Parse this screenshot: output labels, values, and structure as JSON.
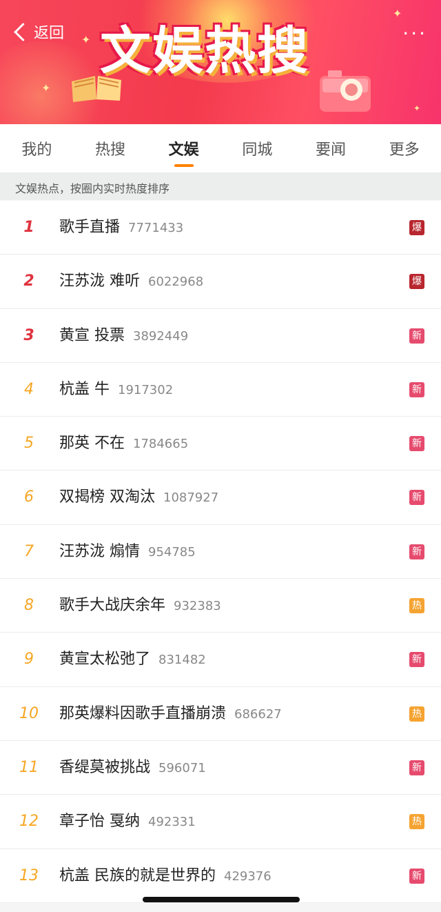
{
  "header": {
    "back_label": "返回",
    "title": "文娱热搜",
    "more_label": "···",
    "brand_color": "#f43a4d"
  },
  "tabs": [
    {
      "label": "我的",
      "active": false
    },
    {
      "label": "热搜",
      "active": false
    },
    {
      "label": "文娱",
      "active": true
    },
    {
      "label": "同城",
      "active": false
    },
    {
      "label": "要闻",
      "active": false
    },
    {
      "label": "更多",
      "active": false
    }
  ],
  "subheader": {
    "text": "文娱热点，按圈内实时热度排序"
  },
  "badge_colors": {
    "爆": "#b8262e",
    "新": "#e64b6e",
    "热": "#f5a331"
  },
  "list": [
    {
      "rank": "1",
      "title": "歌手直播",
      "count": "7771433",
      "badge": "爆"
    },
    {
      "rank": "2",
      "title": "汪苏泷 难听",
      "count": "6022968",
      "badge": "爆"
    },
    {
      "rank": "3",
      "title": "黄宣 投票",
      "count": "3892449",
      "badge": "新"
    },
    {
      "rank": "4",
      "title": "杭盖 牛",
      "count": "1917302",
      "badge": "新"
    },
    {
      "rank": "5",
      "title": "那英 不在",
      "count": "1784665",
      "badge": "新"
    },
    {
      "rank": "6",
      "title": "双揭榜 双淘汰",
      "count": "1087927",
      "badge": "新"
    },
    {
      "rank": "7",
      "title": "汪苏泷 煽情",
      "count": "954785",
      "badge": "新"
    },
    {
      "rank": "8",
      "title": "歌手大战庆余年",
      "count": "932383",
      "badge": "热"
    },
    {
      "rank": "9",
      "title": "黄宣太松弛了",
      "count": "831482",
      "badge": "新"
    },
    {
      "rank": "10",
      "title": "那英爆料因歌手直播崩溃",
      "count": "686627",
      "badge": "热"
    },
    {
      "rank": "11",
      "title": "香缇莫被挑战",
      "count": "596071",
      "badge": "新"
    },
    {
      "rank": "12",
      "title": "章子怡 戛纳",
      "count": "492331",
      "badge": "热"
    },
    {
      "rank": "13",
      "title": "杭盖 民族的就是世界的",
      "count": "429376",
      "badge": "新"
    }
  ]
}
